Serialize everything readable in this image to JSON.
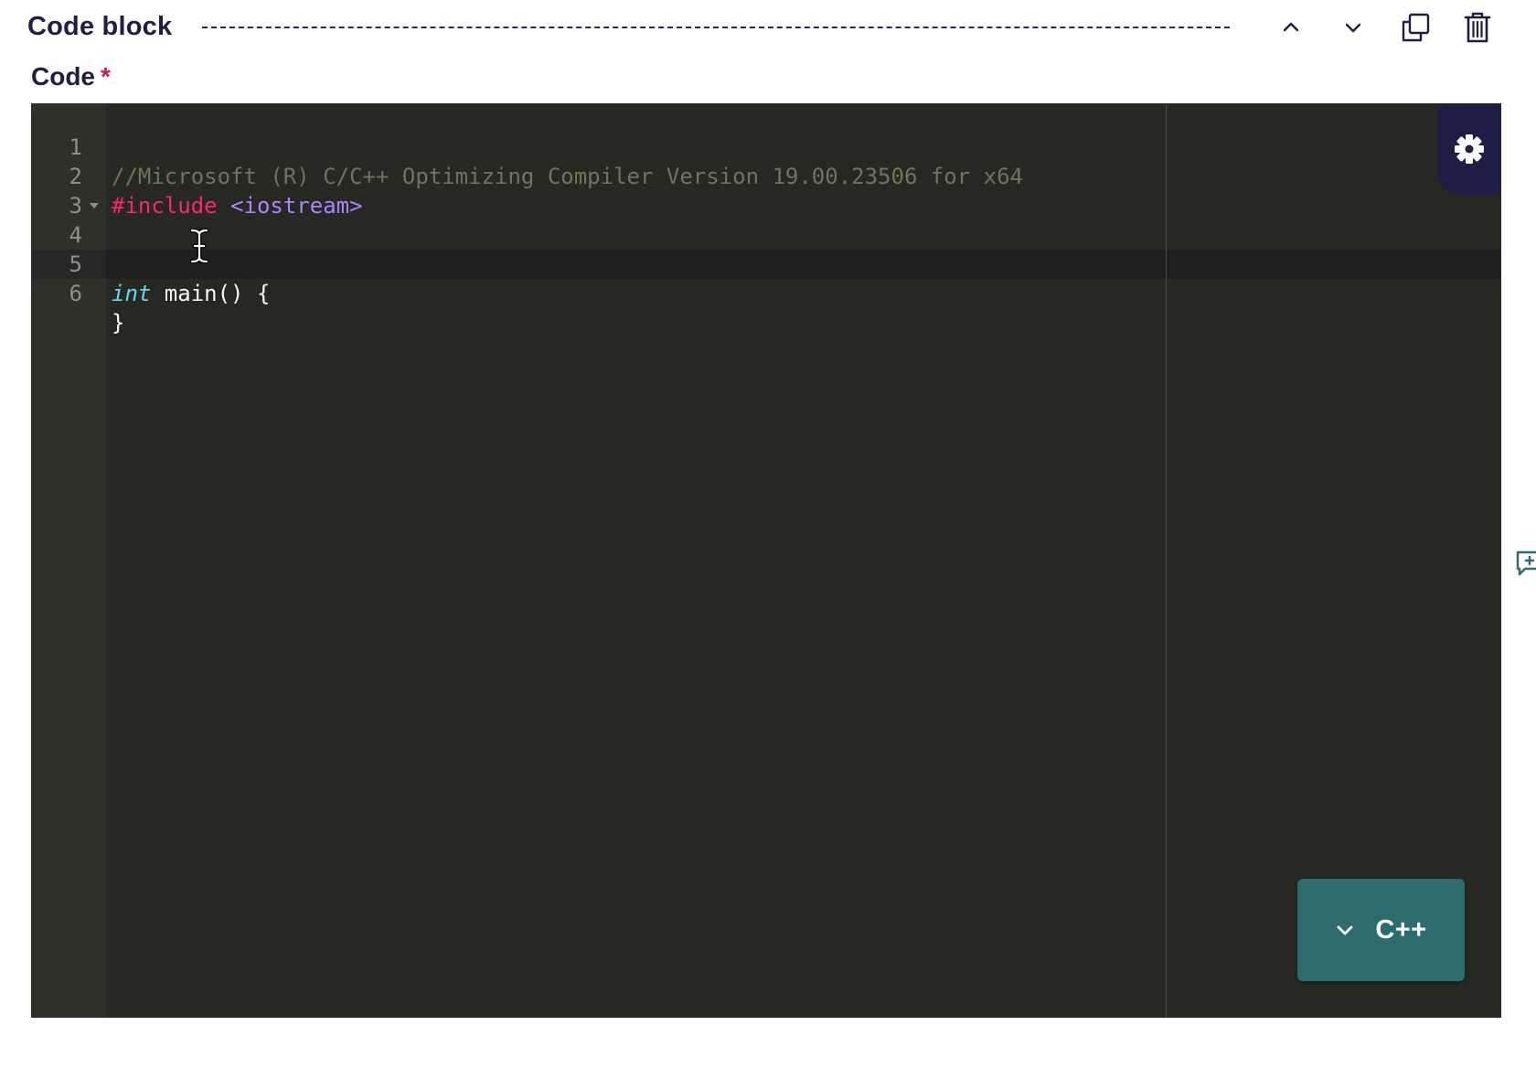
{
  "block": {
    "title": "Code block",
    "actions": {
      "move_up_icon": "chevron-up-icon",
      "move_down_icon": "chevron-down-icon",
      "duplicate_icon": "copy-icon",
      "delete_icon": "trash-icon"
    }
  },
  "field": {
    "label": "Code",
    "required_mark": "*"
  },
  "editor": {
    "theme_colors": {
      "background": "#272822",
      "comment": "#75715e",
      "directive": "#f92672",
      "include": "#ae81ff",
      "type": "#66d9ef"
    },
    "lines": [
      {
        "number": "1",
        "comment": "//Microsoft (R) C/C++ Optimizing Compiler Version 19.00.23506 for x64"
      },
      {
        "number": "2",
        "directive": "#include",
        "include": " <iostream>"
      },
      {
        "number": "3"
      },
      {
        "number": "4",
        "type": "int",
        "text": " main() {"
      },
      {
        "number": "5"
      },
      {
        "number": "6",
        "text": "}"
      }
    ],
    "settings_icon": "gear-icon"
  },
  "language": {
    "selected": "C++",
    "icon": "chevron-down-icon"
  }
}
